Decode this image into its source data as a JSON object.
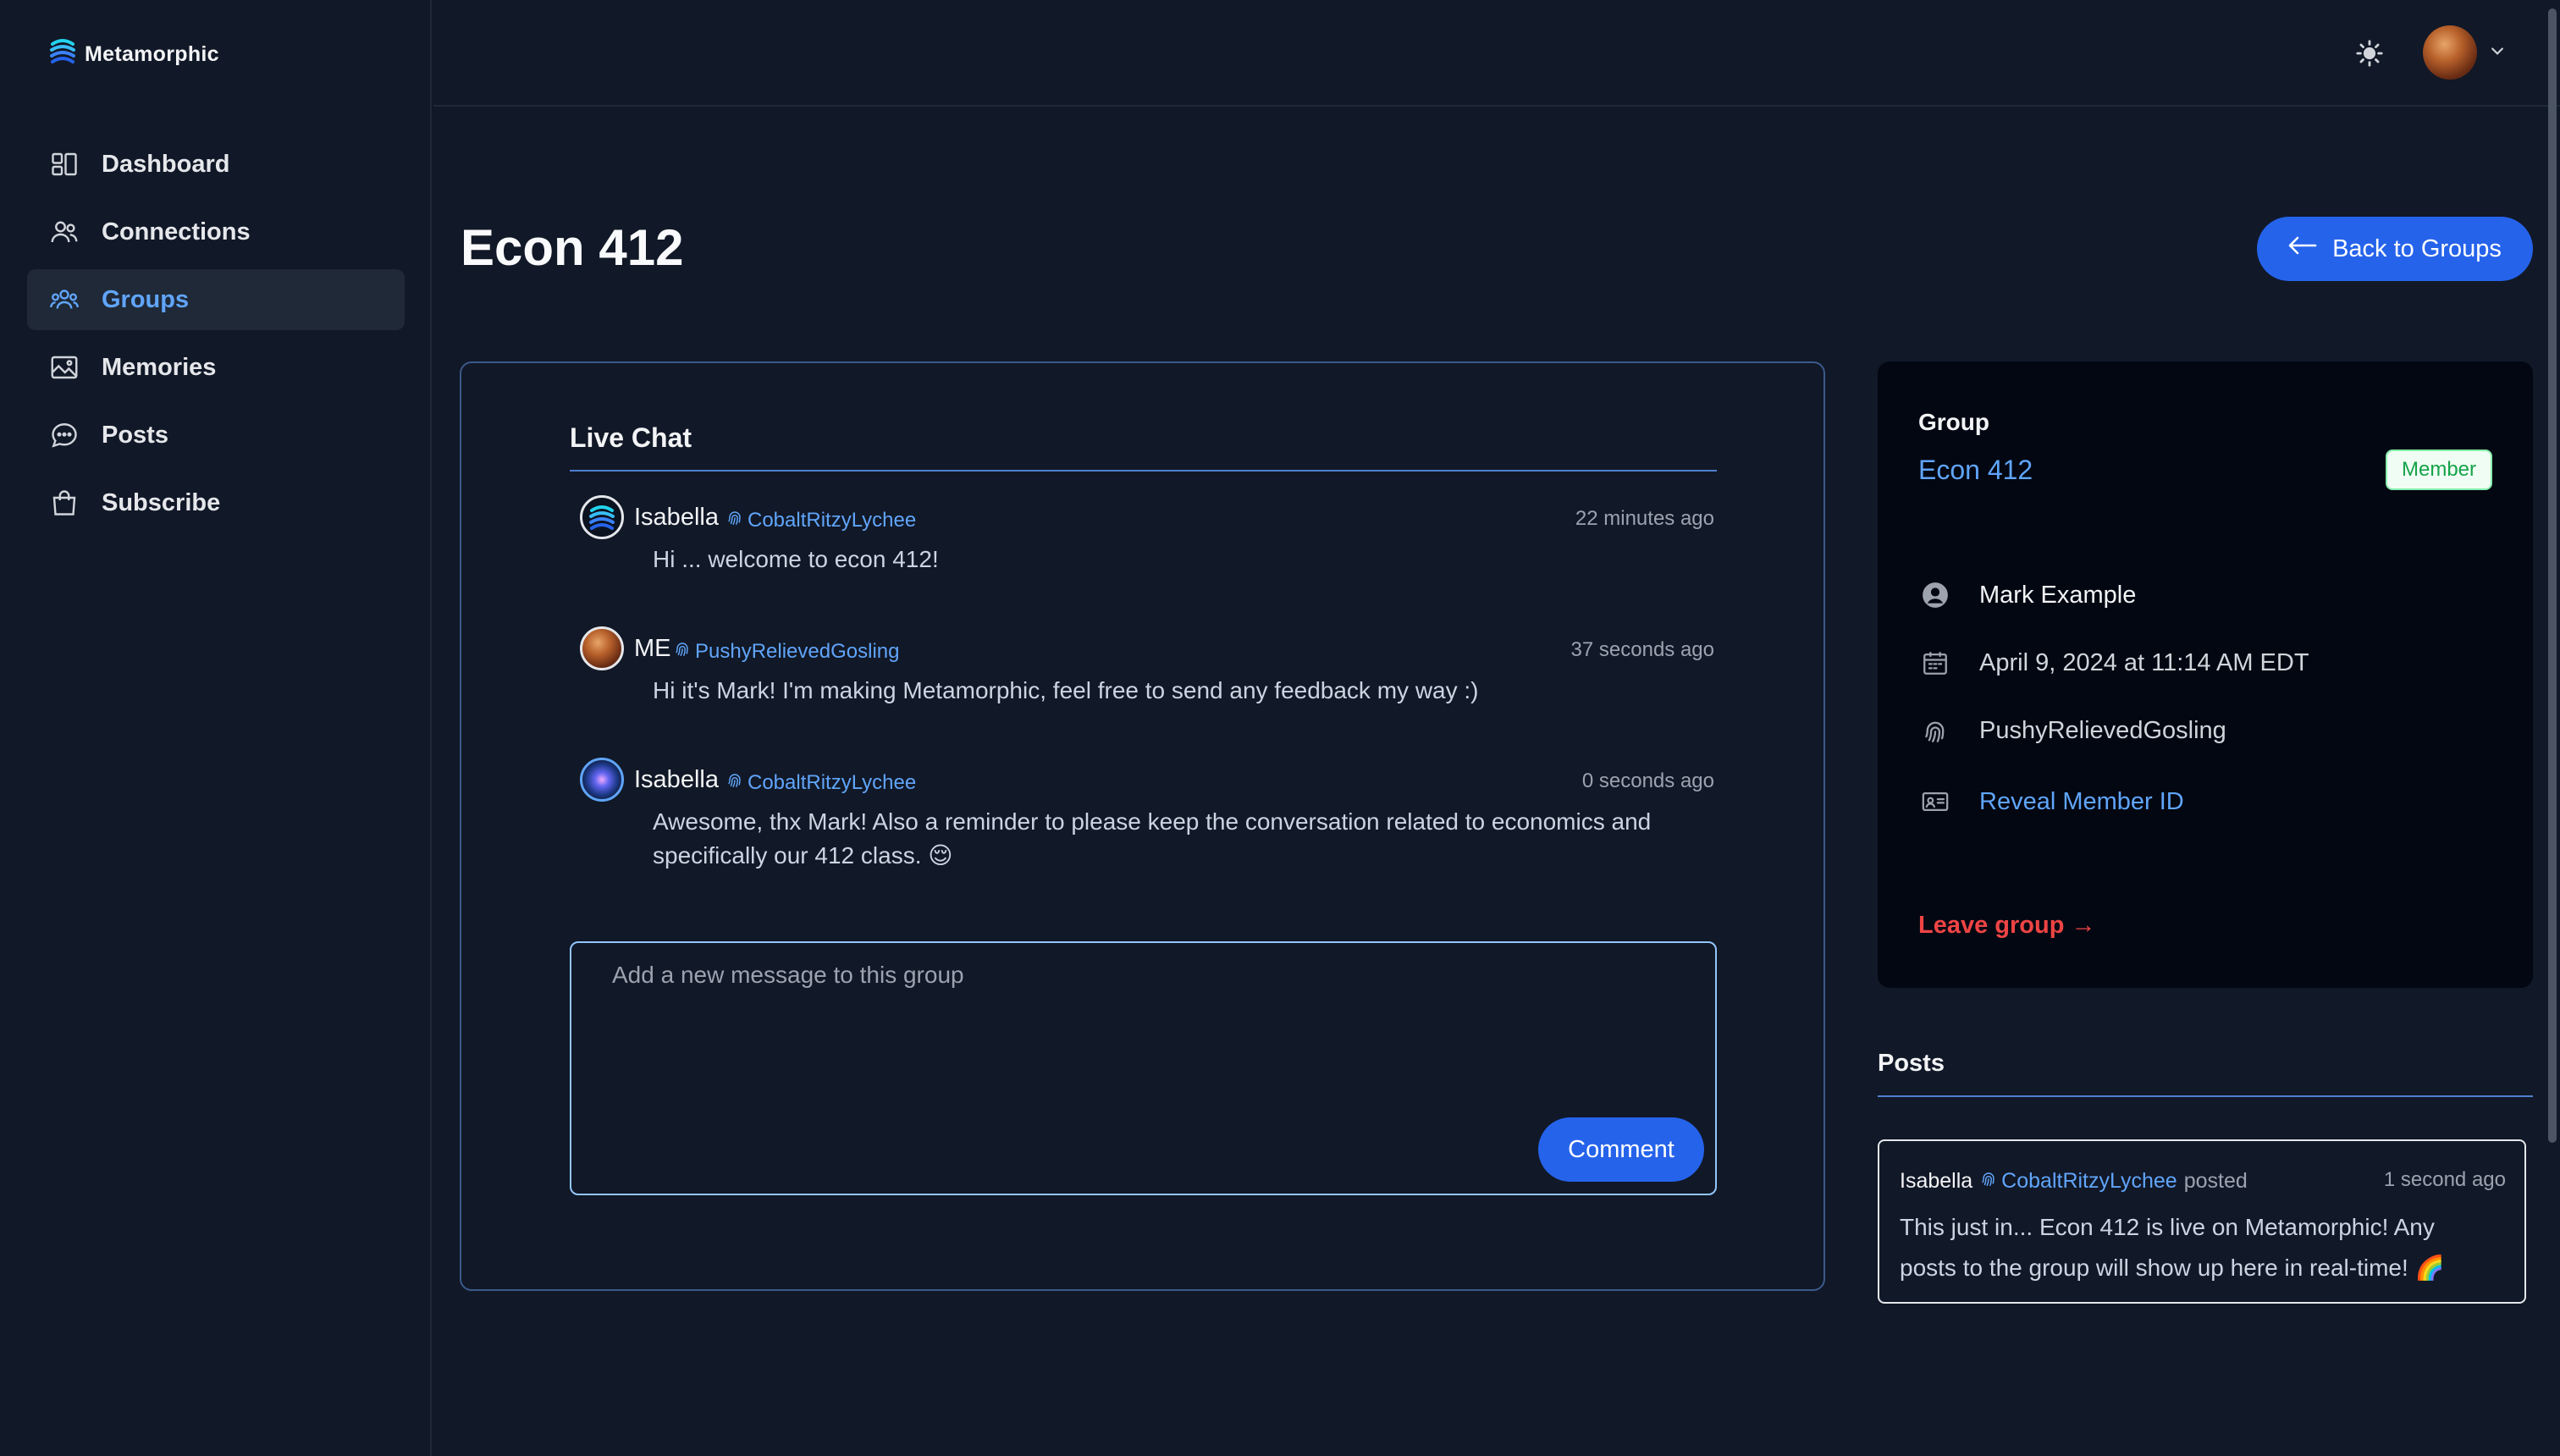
{
  "app": {
    "name": "Metamorphic"
  },
  "sidebar": {
    "items": [
      {
        "label": "Dashboard",
        "icon": "dashboard-icon",
        "active": false
      },
      {
        "label": "Connections",
        "icon": "users-icon",
        "active": false
      },
      {
        "label": "Groups",
        "icon": "user-group-icon",
        "active": true
      },
      {
        "label": "Memories",
        "icon": "photo-icon",
        "active": false
      },
      {
        "label": "Posts",
        "icon": "chat-bubble-icon",
        "active": false
      },
      {
        "label": "Subscribe",
        "icon": "shopping-bag-icon",
        "active": false
      }
    ]
  },
  "header": {
    "theme_icon": "sun-icon",
    "menu_icon": "chevron-down-icon"
  },
  "page": {
    "title": "Econ 412",
    "back_label": "Back to Groups"
  },
  "chat": {
    "title": "Live Chat",
    "messages": [
      {
        "name": "Isabella",
        "handle": "CobaltRitzyLychee",
        "time": "22 minutes ago",
        "text": "Hi ... welcome to econ 412!"
      },
      {
        "name": "ME",
        "handle": "PushyRelievedGosling",
        "time": "37 seconds ago",
        "text": "Hi it's Mark! I'm making Metamorphic, feel free to send any feedback my way :)"
      },
      {
        "name": "Isabella",
        "handle": "CobaltRitzyLychee",
        "time": "0 seconds ago",
        "text": "Awesome, thx Mark! Also a reminder to please keep the conversation related to economics and specifically our 412 class. 😌"
      }
    ],
    "input_placeholder": "Add a new message to this group",
    "input_value": "",
    "submit_label": "Comment"
  },
  "group": {
    "label": "Group",
    "name": "Econ 412",
    "badge": "Member",
    "owner": "Mark Example",
    "created": "April 9, 2024 at 11:14 AM EDT",
    "member_handle": "PushyRelievedGosling",
    "reveal_label": "Reveal Member ID",
    "leave_label": "Leave group →"
  },
  "posts": {
    "title": "Posts",
    "items": [
      {
        "name": "Isabella",
        "handle": "CobaltRitzyLychee",
        "verb": "posted",
        "time": "1 second ago",
        "text": "This just in... Econ 412 is live on Metamorphic! Any posts to the group will show up here in real-time! 🌈"
      }
    ]
  },
  "colors": {
    "accent": "#2563eb",
    "link": "#60a5fa",
    "danger": "#ef4444",
    "success": "#16a34a",
    "background": "#111827"
  }
}
